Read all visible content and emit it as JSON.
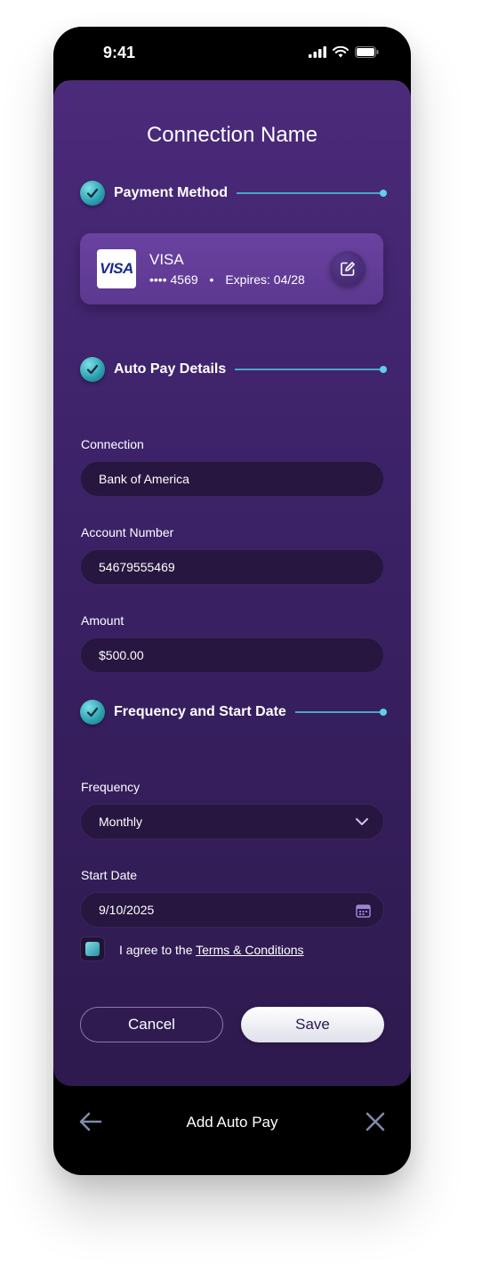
{
  "status_bar": {
    "time": "9:41"
  },
  "header": {
    "title": "Connection Name"
  },
  "sections": {
    "payment_method": "Payment Method",
    "auto_pay_details": "Auto Pay Details",
    "frequency_start": "Frequency and Start Date"
  },
  "card": {
    "logo_text": "VISA",
    "brand": "VISA",
    "masked_number": "•••• 4569",
    "separator": "•",
    "expiry": "Expires: 04/28"
  },
  "fields": {
    "connection": {
      "label": "Connection",
      "value": "Bank of America"
    },
    "account_number": {
      "label": "Account Number",
      "value": "54679555469"
    },
    "amount": {
      "label": "Amount",
      "value": "$500.00"
    },
    "frequency": {
      "label": "Frequency",
      "value": "Monthly"
    },
    "start_date": {
      "label": "Start Date",
      "value": "9/10/2025"
    }
  },
  "agreement": {
    "prefix": "I agree to the ",
    "link": "Terms & Conditions",
    "checked": true
  },
  "actions": {
    "cancel": "Cancel",
    "save": "Save"
  },
  "bottom_bar": {
    "title": "Add Auto Pay"
  },
  "colors": {
    "accent_teal": "#4aa6c8",
    "sheet_top": "#4b2a7a",
    "sheet_bottom": "#2e1a4e",
    "field_bg": "#271640"
  },
  "icons": {
    "check": "checkmark-icon",
    "edit": "edit-icon",
    "dropdown": "chevron-down-icon",
    "calendar": "calendar-icon",
    "back": "arrow-left-icon",
    "close": "close-icon"
  }
}
